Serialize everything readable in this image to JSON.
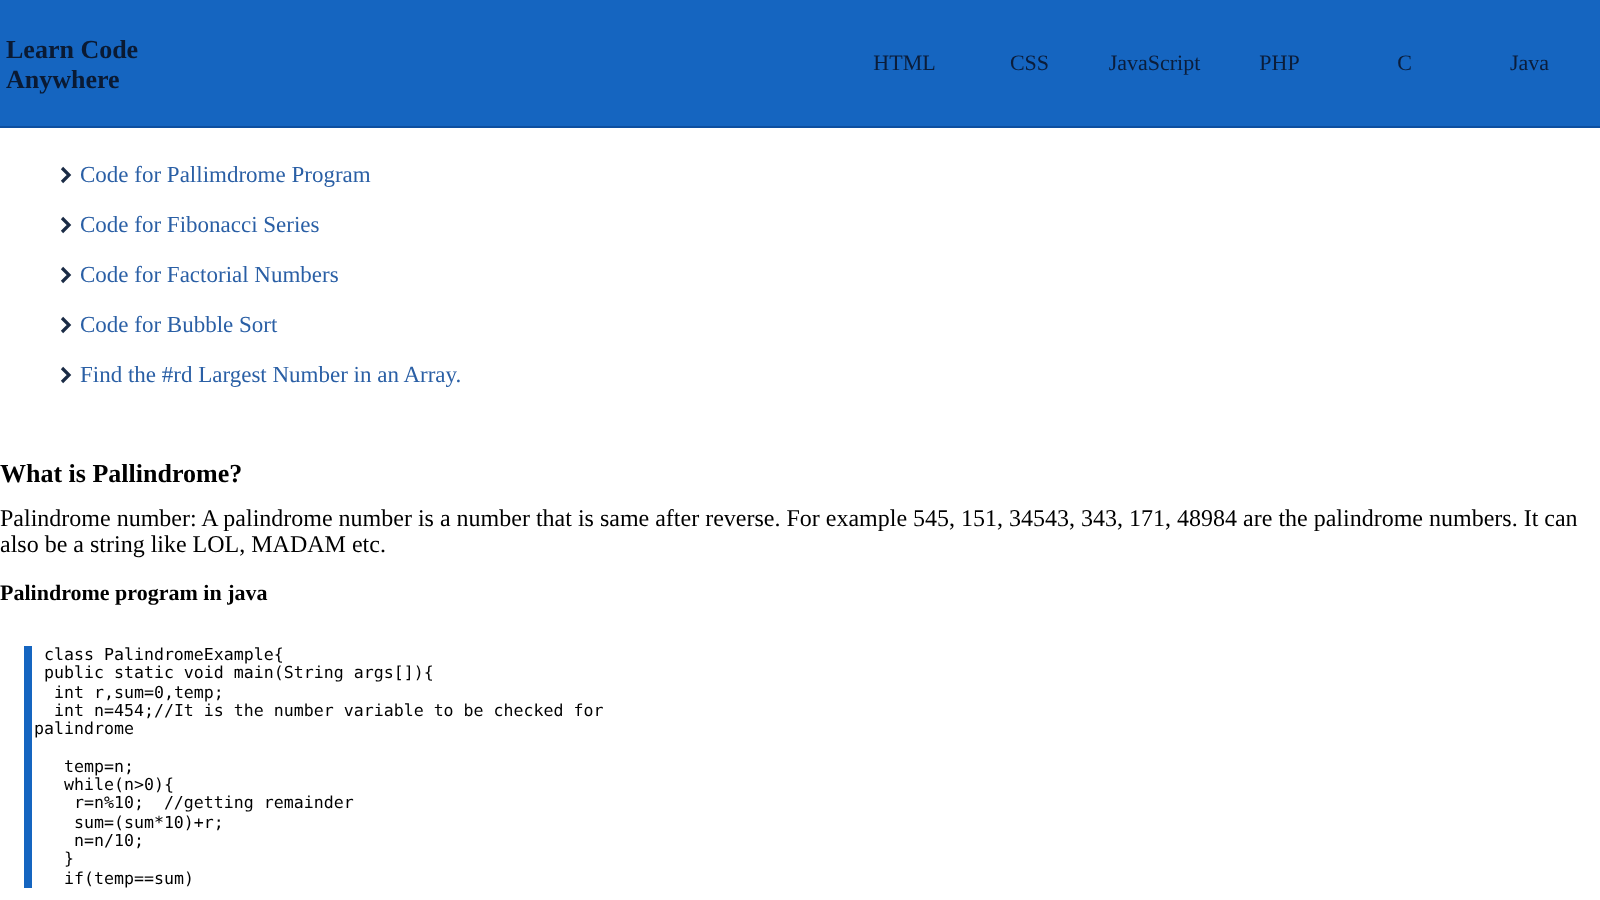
{
  "header": {
    "title": "Learn Code Anywhere",
    "nav": [
      "HTML",
      "CSS",
      "JavaScript",
      "PHP",
      "C",
      "Java"
    ]
  },
  "links": [
    "Code for Pallimdrome Program",
    "Code for Fibonacci Series",
    "Code for Factorial Numbers",
    "Code for Bubble Sort",
    "Find the #rd Largest Number in an Array."
  ],
  "article": {
    "heading": "What is Pallindrome?",
    "paragraph": "Palindrome number: A palindrome number is a number that is same after reverse. For example 545, 151, 34543, 343, 171, 48984 are the palindrome numbers. It can also be a string like LOL, MADAM etc.",
    "subheading": "Palindrome program in java",
    "code": " class PalindromeExample{\n public static void main(String args[]){\n  int r,sum=0,temp;\n  int n=454;//It is the number variable to be checked for palindrome\n\n   temp=n;\n   while(n>0){\n    r=n%10;  //getting remainder\n    sum=(sum*10)+r;\n    n=n/10;\n   }\n   if(temp==sum)"
  }
}
